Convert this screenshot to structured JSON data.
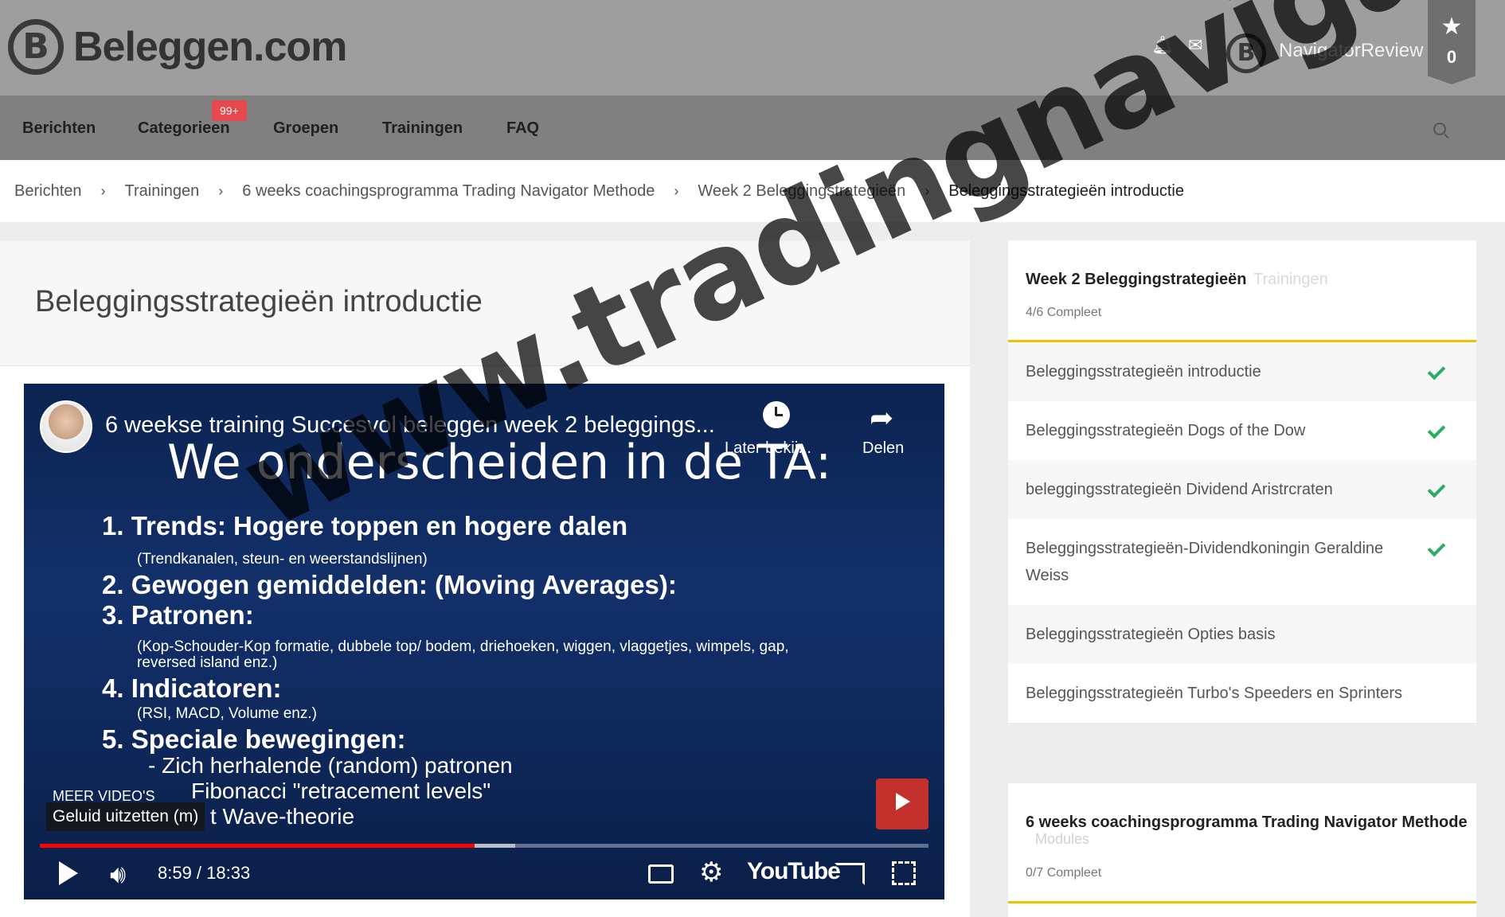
{
  "header": {
    "brand": "Beleggen.com",
    "user_name": "NavigatorReview",
    "favorites_count": "0",
    "icons": [
      "bell-icon",
      "envelope-icon",
      "star-icon"
    ]
  },
  "nav": {
    "items": [
      "Berichten",
      "Categorieen",
      "Groepen",
      "Trainingen",
      "FAQ"
    ],
    "badge": "99+"
  },
  "breadcrumb": [
    "Berichten",
    "Trainingen",
    "6 weeks coachingsprogramma Trading Navigator Methode",
    "Week 2 Beleggingstrategieën",
    "Beleggingsstrategieën introductie"
  ],
  "page": {
    "title": "Beleggingsstrategieën introductie"
  },
  "video": {
    "title": "6 weekse training Succesvol beleggen week 2 beleggings...",
    "later_label": "Later bekij...",
    "share_label": "Delen",
    "slide_heading": "We onderscheiden in de TA:",
    "slide_lines": [
      "1.  Trends: Hogere toppen en hogere dalen",
      "2.  Gewogen gemiddelden: (Moving Averages):",
      "3.  Patronen:",
      "4.  Indicatoren:",
      "5.  Speciale bewegingen:"
    ],
    "slide_subs": [
      "(Trendkanalen, steun- en weerstandslijnen)",
      "(Kop-Schouder-Kop formatie, dubbele top/ bodem, driehoeken, wiggen, vlaggetjes, wimpels, gap,",
      "reversed island enz.)",
      "(RSI, MACD, Volume enz.)",
      "- Zich herhalende (random) patronen",
      "Fibonacci  \"retracement levels\"",
      "t Wave-theorie"
    ],
    "more_videos": "MEER VIDEO'S",
    "mute_tooltip": "Geluid uitzetten (m)",
    "time": "8:59 / 18:33",
    "played_fraction": 0.489,
    "buffered_fraction": 0.535,
    "youtube_label": "YouTube"
  },
  "sidebar": {
    "week_title": "Week 2 Beleggingstrategieën",
    "week_tag": "Trainingen",
    "week_progress": "4/6 Compleet",
    "lessons": [
      {
        "label": "Beleggingsstrategieën introductie",
        "done": true
      },
      {
        "label": "Beleggingsstrategieën Dogs of the Dow",
        "done": true
      },
      {
        "label": "beleggingsstrategieën Dividend Aristrcraten",
        "done": true
      },
      {
        "label": "Beleggingsstrategieën-Dividendkoningin Geraldine Weiss",
        "done": true
      },
      {
        "label": "Beleggingsstrategieën Opties basis",
        "done": false
      },
      {
        "label": "Beleggingsstrategieën Turbo's Speeders en Sprinters",
        "done": false
      }
    ],
    "program_title": "6 weeks coachingsprogramma Trading Navigator Methode",
    "program_tag": "Modules",
    "program_progress": "0/7 Compleet"
  },
  "watermark": "www.tradingnavigatorreview.nl",
  "colors": {
    "accent": "#f2c200",
    "check": "#27ae60",
    "badge": "#e5484d",
    "progress": "#ff0000"
  }
}
